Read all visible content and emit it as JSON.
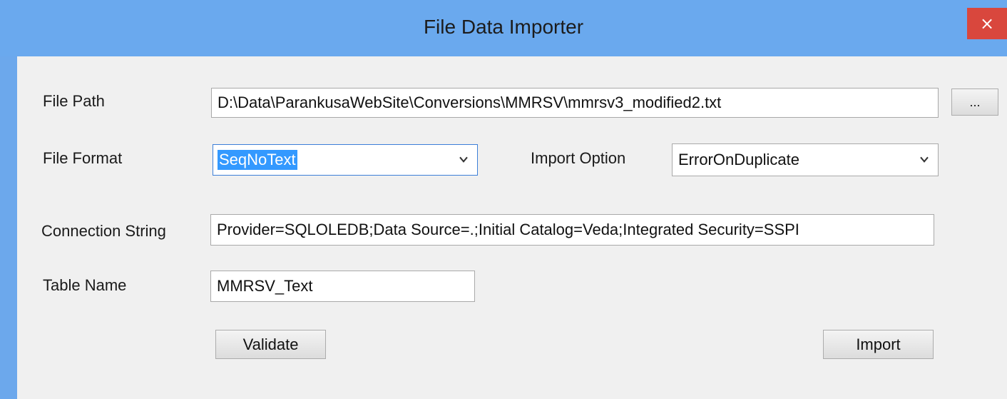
{
  "window": {
    "title": "File Data Importer",
    "close_glyph": "×"
  },
  "form": {
    "file_path": {
      "label": "File Path",
      "value": "D:\\Data\\ParankusaWebSite\\Conversions\\MMRSV\\mmrsv3_modified2.txt",
      "browse_label": "..."
    },
    "file_format": {
      "label": "File Format",
      "value": "SeqNoText"
    },
    "import_option": {
      "label": "Import Option",
      "value": "ErrorOnDuplicate"
    },
    "connection_string": {
      "label": "Connection String",
      "value": "Provider=SQLOLEDB;Data Source=.;Initial Catalog=Veda;Integrated Security=SSPI"
    },
    "table_name": {
      "label": "Table Name",
      "value": "MMRSV_Text"
    },
    "validate_label": "Validate",
    "import_label": "Import"
  },
  "icons": {
    "close": "close-icon",
    "dropdown": "chevron-down-icon"
  },
  "colors": {
    "titlebar": "#6aa9ee",
    "close_button": "#d9473d",
    "selection": "#3399ff",
    "client_background": "#f0f0f0"
  }
}
